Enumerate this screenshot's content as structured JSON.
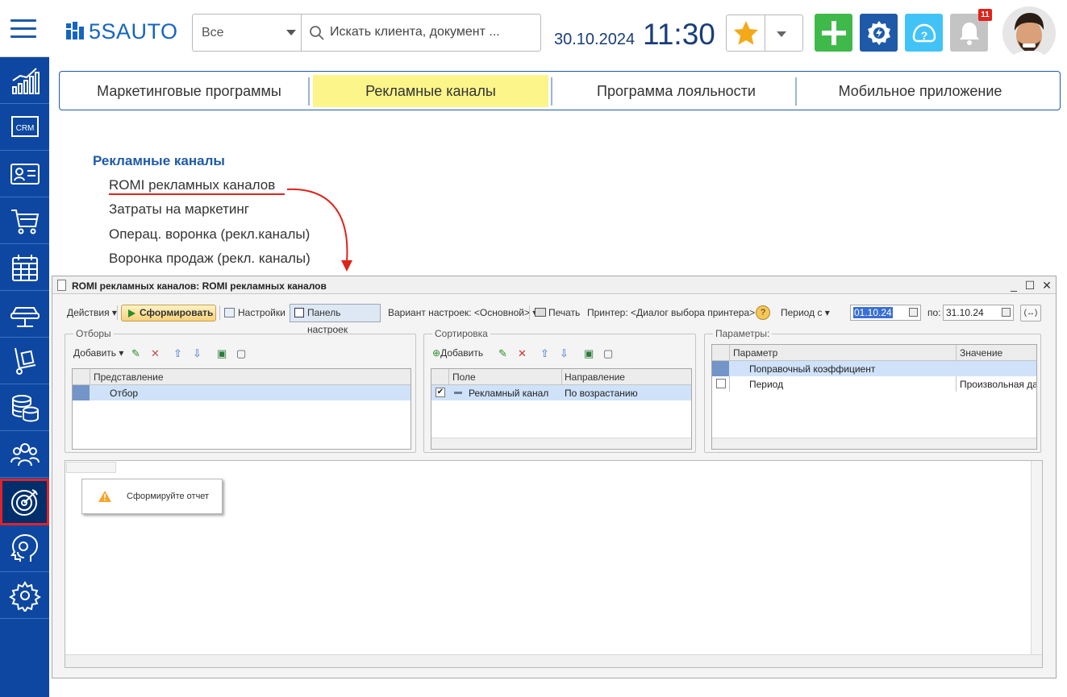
{
  "header": {
    "logo_text": "5SAUTO",
    "search_scope": "Все",
    "search_placeholder": "Искать клиента, документ ...",
    "date": "30.10.2024",
    "time": "11:30",
    "notification_count": "11"
  },
  "colors": {
    "brand_blue": "#0d47a1",
    "tab_active": "#fbf58a",
    "add_button": "#3fba4a",
    "settings_button": "#1e5aa8",
    "help_button": "#42c3f7",
    "bell_button": "#c4c4c4"
  },
  "tabs": [
    {
      "label": "Маркетинговые программы"
    },
    {
      "label": "Рекламные каналы"
    },
    {
      "label": "Программа лояльности"
    },
    {
      "label": "Мобильное приложение"
    }
  ],
  "menu": {
    "heading": "Рекламные каналы",
    "items": [
      {
        "label": "ROMI рекламных каналов"
      },
      {
        "label": "Затраты на маркетинг"
      },
      {
        "label": "Операц. воронка (рекл.каналы)"
      },
      {
        "label": "Воронка продаж (рекл. каналы)"
      }
    ]
  },
  "report": {
    "title": "ROMI рекламных каналов: ROMI рекламных каналов",
    "toolbar": {
      "actions": "Действия",
      "run": "Сформировать",
      "settings": "Настройки",
      "panel": "Панель настроек",
      "variant": "Вариант настроек: <Основной>",
      "print": "Печать",
      "printer": "Принтер: <Диалог выбора принтера>",
      "period_from_label": "Период с",
      "date_from": "01.10.24",
      "to_label": "по:",
      "date_to": "31.10.24",
      "period_button": "(↔)"
    },
    "filters": {
      "title": "Отборы",
      "add": "Добавить",
      "header": "Представление",
      "rows": [
        "Отбор"
      ]
    },
    "sorting": {
      "title": "Сортировка",
      "add": "Добавить",
      "col_field": "Поле",
      "col_direction": "Направление",
      "rows": [
        {
          "field": "Рекламный канал",
          "direction": "По возрастанию"
        }
      ]
    },
    "params": {
      "title": "Параметры:",
      "col_param": "Параметр",
      "col_value": "Значение",
      "rows": [
        {
          "param": "Поправочный коэффициент",
          "value": ""
        },
        {
          "param": "Период",
          "value": "Произвольная дата"
        }
      ]
    },
    "message": "Сформируйте отчет"
  },
  "sidebar": {
    "items": [
      {
        "icon": "analytics-icon"
      },
      {
        "icon": "crm-icon"
      },
      {
        "icon": "contacts-icon"
      },
      {
        "icon": "cart-icon"
      },
      {
        "icon": "calendar-icon"
      },
      {
        "icon": "car-lift-icon"
      },
      {
        "icon": "parts-icon"
      },
      {
        "icon": "finance-icon"
      },
      {
        "icon": "staff-icon"
      },
      {
        "icon": "marketing-target-icon"
      },
      {
        "icon": "support-icon"
      },
      {
        "icon": "settings-icon"
      }
    ]
  }
}
